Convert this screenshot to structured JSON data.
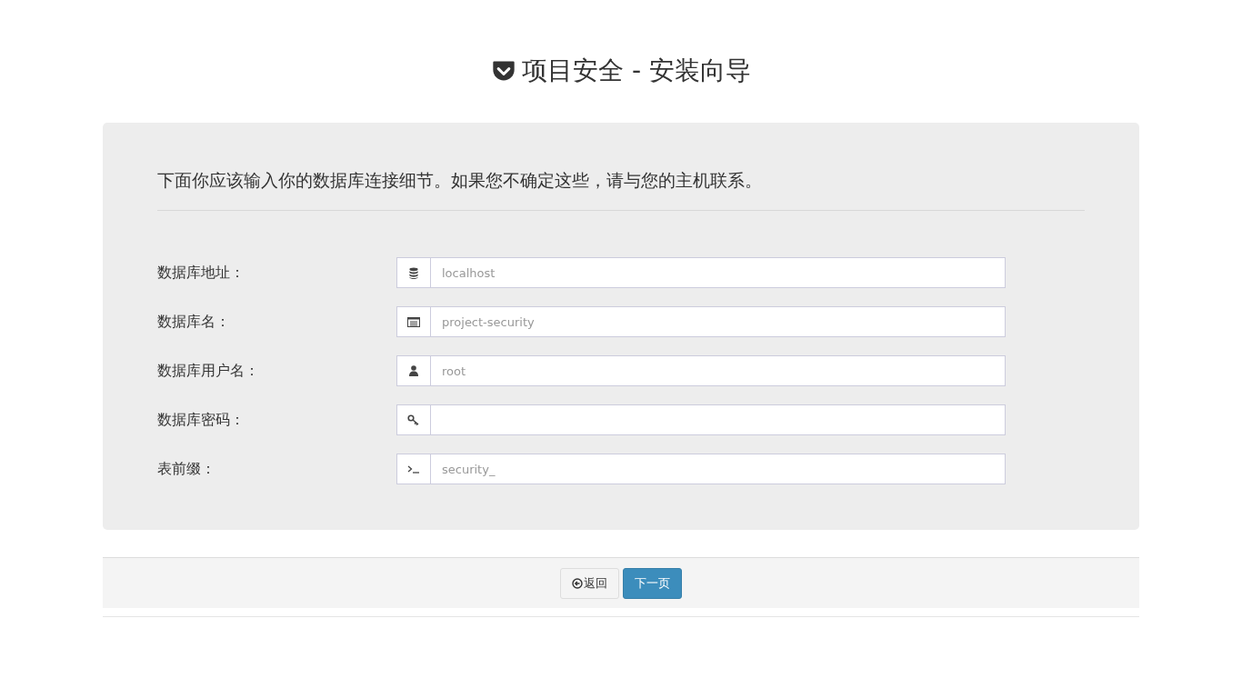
{
  "title": "项目安全 - 安装向导",
  "intro": "下面你应该输入你的数据库连接细节。如果您不确定这些，请与您的主机联系。",
  "fields": [
    {
      "label": "数据库地址：",
      "kind": "database",
      "placeholder": "localhost"
    },
    {
      "label": "数据库名：",
      "kind": "list",
      "placeholder": "project-security"
    },
    {
      "label": "数据库用户名：",
      "kind": "user",
      "placeholder": "root"
    },
    {
      "label": "数据库密码：",
      "kind": "key"
    },
    {
      "label": "表前缀：",
      "kind": "terminal",
      "placeholder": "security_"
    }
  ],
  "buttons": {
    "back": "返回",
    "next": "下一页"
  }
}
